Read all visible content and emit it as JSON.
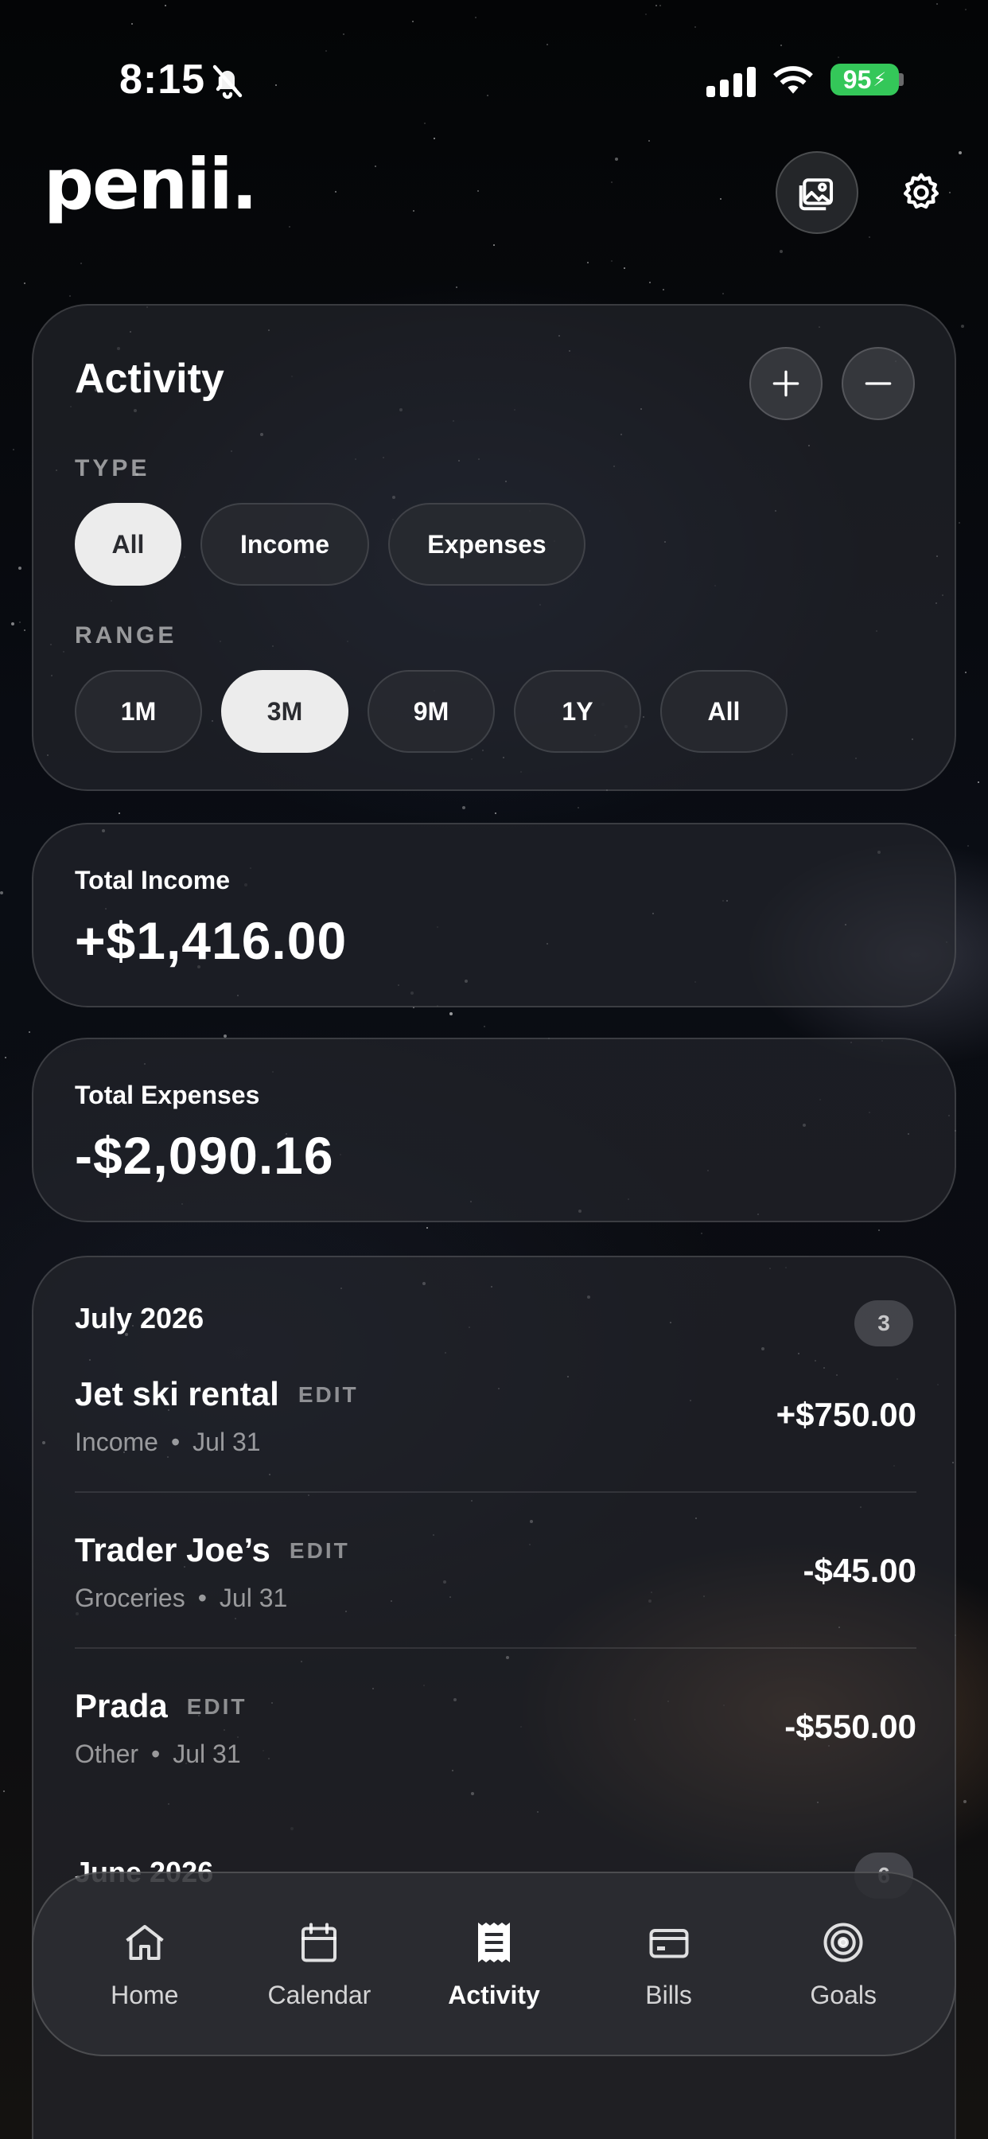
{
  "status_bar": {
    "time": "8:15",
    "battery": "95"
  },
  "header": {
    "logo": "penii."
  },
  "activity": {
    "title": "Activity",
    "type_label": "TYPE",
    "type_options": [
      "All",
      "Income",
      "Expenses"
    ],
    "type_selected": "All",
    "range_label": "RANGE",
    "range_options": [
      "1M",
      "3M",
      "9M",
      "1Y",
      "All"
    ],
    "range_selected": "3M"
  },
  "totals": {
    "income_label": "Total Income",
    "income_value": "+$1,416.00",
    "expenses_label": "Total Expenses",
    "expenses_value": "-$2,090.16"
  },
  "months": [
    {
      "label": "July 2026",
      "count": "3",
      "transactions": [
        {
          "name": "Jet ski rental",
          "edit": "EDIT",
          "category": "Income",
          "date": "Jul 31",
          "amount": "+$750.00"
        },
        {
          "name": "Trader Joe’s",
          "edit": "EDIT",
          "category": "Groceries",
          "date": "Jul 31",
          "amount": "-$45.00"
        },
        {
          "name": "Prada",
          "edit": "EDIT",
          "category": "Other",
          "date": "Jul 31",
          "amount": "-$550.00"
        }
      ]
    },
    {
      "label": "June 2026",
      "count": "6"
    }
  ],
  "tab_bar": {
    "tabs": [
      {
        "label": "Home",
        "icon": "home-icon"
      },
      {
        "label": "Calendar",
        "icon": "calendar-icon"
      },
      {
        "label": "Activity",
        "icon": "receipt-icon"
      },
      {
        "label": "Bills",
        "icon": "card-icon"
      },
      {
        "label": "Goals",
        "icon": "target-icon"
      }
    ],
    "active": "Activity"
  },
  "colors": {
    "battery": "#34c759",
    "chip_active": "#ececec"
  }
}
